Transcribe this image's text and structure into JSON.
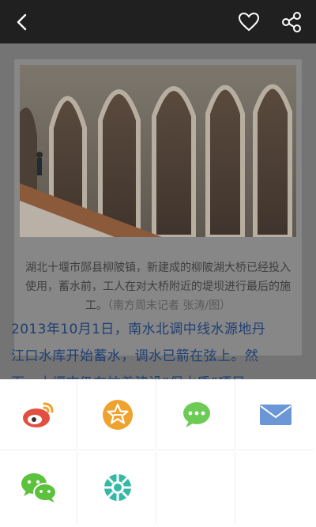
{
  "toolbar": {
    "back_icon": "back-chevron-icon",
    "favorite_icon": "heart-icon",
    "share_icon": "share-icon"
  },
  "photo": {
    "caption": "湖北十堰市郧县柳陂镇，新建成的柳陂湖大桥已经投入使用，蓄水前，工人在对大桥附近的堤坝进行最后的施工。",
    "credit": "（南方周末记者 张涛/图）"
  },
  "article": {
    "line1": "2013年10月1日，南水北调中线水源地丹",
    "line2": "江口水库开始蓄水，调水已箭在弦上。然",
    "line3": "而，十堰市仍在忙着建设“保水质”项目"
  },
  "share_targets": [
    {
      "name": "weibo",
      "color": "#e24f40"
    },
    {
      "name": "qzone",
      "color": "#f0a22e"
    },
    {
      "name": "messages",
      "color": "#6ccb55"
    },
    {
      "name": "email",
      "color": "#6c97d6"
    },
    {
      "name": "wechat",
      "color": "#5cc13b"
    },
    {
      "name": "wechat-moments",
      "color": "#35b9a6"
    }
  ]
}
